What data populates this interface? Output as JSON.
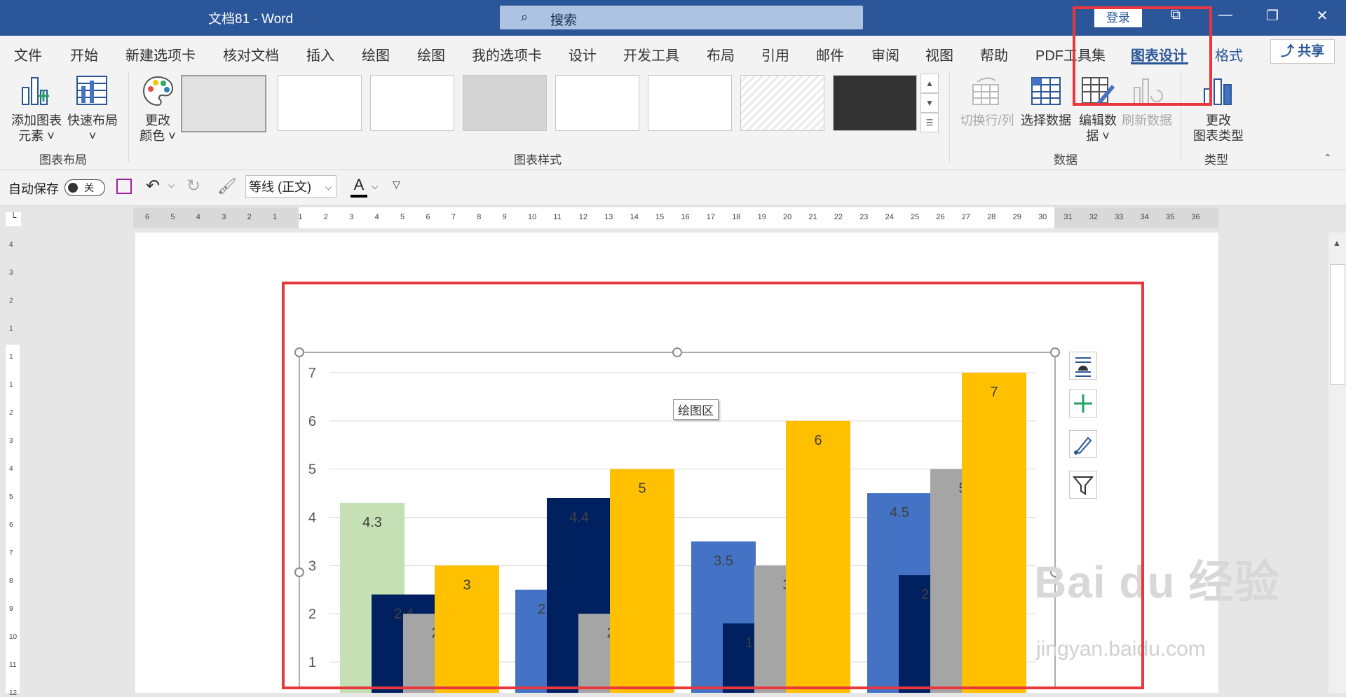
{
  "titlebar": {
    "doc_title": "文档81 - Word",
    "search_placeholder": "搜索",
    "login_label": "登录",
    "icons": [
      "search-icon",
      "ribbon-display-icon",
      "minimize-icon",
      "restore-icon",
      "close-icon"
    ]
  },
  "tabs": [
    {
      "label": "文件"
    },
    {
      "label": "开始"
    },
    {
      "label": "新建选项卡"
    },
    {
      "label": "核对文档"
    },
    {
      "label": "插入"
    },
    {
      "label": "绘图"
    },
    {
      "label": "绘图"
    },
    {
      "label": "我的选项卡"
    },
    {
      "label": "设计"
    },
    {
      "label": "开发工具"
    },
    {
      "label": "布局"
    },
    {
      "label": "引用"
    },
    {
      "label": "邮件"
    },
    {
      "label": "审阅"
    },
    {
      "label": "视图"
    },
    {
      "label": "帮助"
    },
    {
      "label": "PDF工具集"
    },
    {
      "label": "图表设计",
      "active": true
    },
    {
      "label": "格式"
    }
  ],
  "share_label": "共享",
  "ribbon": {
    "layout_group": {
      "label": "图表布局",
      "add_element_line1": "添加图表",
      "add_element_line2": "元素 ˅",
      "quick_layout_line1": "快速布局",
      "quick_layout_line2": "˅"
    },
    "styles_group": {
      "label": "图表样式",
      "change_colors_line1": "更改",
      "change_colors_line2": "颜色 ˅",
      "style_count": 8
    },
    "data_group": {
      "label": "数据",
      "switch_row_col": "切换行/列",
      "select_data": "选择数据",
      "edit_data_line1": "编辑数",
      "edit_data_line2": "据 ˅",
      "refresh_data": "刷新数据"
    },
    "type_group": {
      "label": "类型",
      "change_type_line1": "更改",
      "change_type_line2": "图表类型"
    }
  },
  "qat": {
    "autosave_label": "自动保存",
    "autosave_state": "关",
    "font_name": "等线 (正文)",
    "font_color_glyph": "A",
    "font_color": "#000000"
  },
  "ruler": {
    "h_ticks": [
      "6",
      "5",
      "4",
      "3",
      "2",
      "1",
      "1",
      "2",
      "3",
      "4",
      "5",
      "6",
      "7",
      "8",
      "9",
      "10",
      "11",
      "12",
      "13",
      "14",
      "15",
      "16",
      "17",
      "18",
      "19",
      "20",
      "21",
      "22",
      "23",
      "24",
      "25",
      "26",
      "27",
      "28",
      "29",
      "30",
      "31",
      "32",
      "33",
      "34",
      "35",
      "36"
    ],
    "v_ticks": [
      "4",
      "3",
      "2",
      "1",
      "1",
      "1",
      "2",
      "3",
      "4",
      "5",
      "6",
      "7",
      "8",
      "9",
      "10",
      "11",
      "12"
    ]
  },
  "plot_area_tooltip": "绘图区",
  "watermark": {
    "logo_text": "Bai du 经验",
    "url": "jingyan.baidu.com"
  },
  "chart_data": {
    "type": "bar",
    "ylim": [
      0,
      7
    ],
    "y_ticks": [
      1,
      2,
      3,
      4,
      5,
      6,
      7
    ],
    "groups": [
      {
        "bars": [
          {
            "value": 4.3,
            "label": "4.3",
            "color": "#c5e0b4",
            "offset": 0.0
          },
          {
            "value": 2.4,
            "label": "2.4",
            "color": "#002060",
            "offset": 0.2
          },
          {
            "value": 2,
            "label": "2",
            "color": "#a5a5a5",
            "offset": 0.4
          },
          {
            "value": 3,
            "label": "3",
            "color": "#ffc000",
            "offset": 0.6
          }
        ]
      },
      {
        "bars": [
          {
            "value": 2.5,
            "label": "2.5",
            "color": "#4472c4",
            "offset": 0.0
          },
          {
            "value": 4.4,
            "label": "4.4",
            "color": "#002060",
            "offset": 0.2
          },
          {
            "value": 2,
            "label": "2",
            "color": "#a5a5a5",
            "offset": 0.4
          },
          {
            "value": 5,
            "label": "5",
            "color": "#ffc000",
            "offset": 0.6
          }
        ]
      },
      {
        "bars": [
          {
            "value": 3.5,
            "label": "3.5",
            "color": "#4472c4",
            "offset": 0.0
          },
          {
            "value": 1.8,
            "label": "1.8",
            "color": "#002060",
            "offset": 0.2
          },
          {
            "value": 3,
            "label": "3",
            "color": "#a5a5a5",
            "offset": 0.4
          },
          {
            "value": 6,
            "label": "6",
            "color": "#ffc000",
            "offset": 0.6
          }
        ]
      },
      {
        "bars": [
          {
            "value": 4.5,
            "label": "4.5",
            "color": "#4472c4",
            "offset": 0.0
          },
          {
            "value": 2.8,
            "label": "2.8",
            "color": "#002060",
            "offset": 0.2
          },
          {
            "value": 5,
            "label": "5",
            "color": "#a5a5a5",
            "offset": 0.4
          },
          {
            "value": 7,
            "label": "7",
            "color": "#ffc000",
            "offset": 0.6
          }
        ]
      }
    ],
    "gridlines": true,
    "data_label_color": "#404040"
  }
}
